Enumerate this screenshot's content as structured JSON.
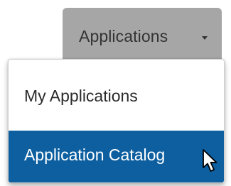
{
  "nav": {
    "tab_label": "Applications",
    "caret_icon": "caret-down-icon"
  },
  "menu": {
    "items": [
      {
        "label": "My Applications",
        "selected": false
      },
      {
        "label": "Application Catalog",
        "selected": true
      }
    ]
  },
  "cursor": {
    "icon": "pointer-arrow-icon"
  },
  "colors": {
    "tab_background": "#a6a6a6",
    "selected_item_background": "#0d5fa0",
    "selected_item_text": "#ffffff",
    "item_text": "#2b2b2b"
  }
}
